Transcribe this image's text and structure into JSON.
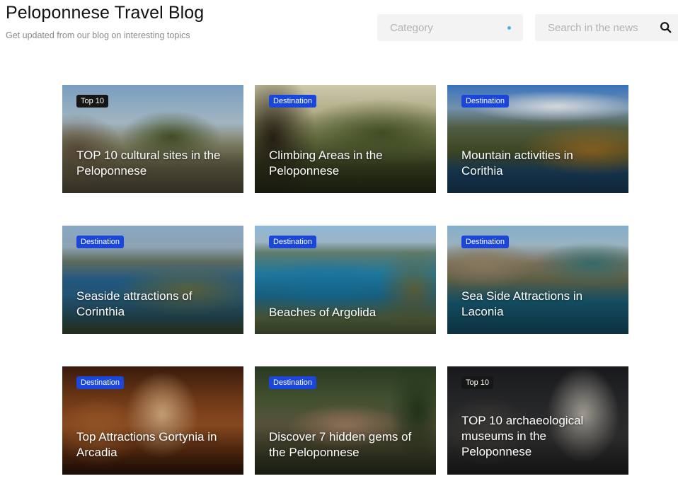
{
  "header": {
    "title": "Peloponnese Travel Blog",
    "subtitle": "Get updated from our blog on interesting topics"
  },
  "filters": {
    "category_placeholder": "Category",
    "search_placeholder": "Search in the news",
    "accent_color": "#41b6e6"
  },
  "badge_colors": {
    "Top 10": "#161616",
    "Destination": "#1a46db"
  },
  "cards": [
    {
      "badge": "Top 10",
      "title": "TOP 10 cultural sites in the Peloponnese"
    },
    {
      "badge": "Destination",
      "title": "Climbing Areas in the Peloponnese"
    },
    {
      "badge": "Destination",
      "title": "Mountain activities in Corithia"
    },
    {
      "badge": "Destination",
      "title": "Seaside attractions of Corinthia"
    },
    {
      "badge": "Destination",
      "title": "Beaches of Argolida"
    },
    {
      "badge": "Destination",
      "title": "Sea Side Attractions in Laconia"
    },
    {
      "badge": "Destination",
      "title": "Top Attractions Gortynia in Arcadia"
    },
    {
      "badge": "Destination",
      "title": "Discover 7 hidden gems of the Peloponnese"
    },
    {
      "badge": "Top 10",
      "title": "TOP 10 archaeological museums in the Peloponnese"
    }
  ]
}
